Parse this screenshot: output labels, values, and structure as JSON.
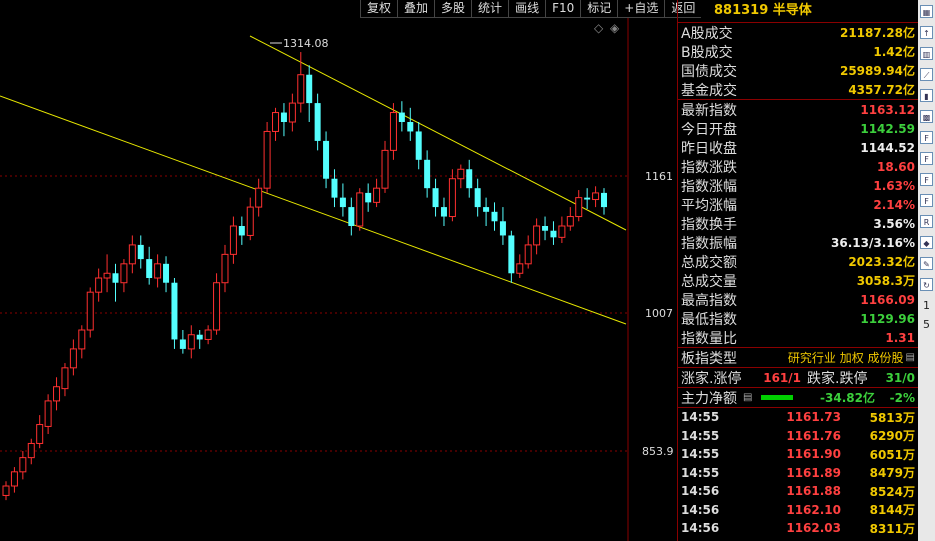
{
  "toolbar": {
    "items": [
      "复权",
      "叠加",
      "多股",
      "统计",
      "画线",
      "F10",
      "标记",
      "+自选",
      "返回"
    ]
  },
  "chart_labels": {
    "high_label": "1314.08",
    "price_1161": "1161",
    "price_1007": "1007",
    "price_853": "853.9"
  },
  "chart_data": {
    "type": "candlestick",
    "title": "",
    "ylim": [
      800,
      1350
    ],
    "gridlines": [
      1161,
      1007,
      853.9
    ],
    "candles": [
      [
        845,
        855,
        840,
        860
      ],
      [
        855,
        870,
        848,
        875
      ],
      [
        870,
        885,
        862,
        892
      ],
      [
        885,
        900,
        878,
        905
      ],
      [
        900,
        920,
        895,
        930
      ],
      [
        918,
        945,
        910,
        952
      ],
      [
        945,
        960,
        935,
        970
      ],
      [
        958,
        980,
        950,
        985
      ],
      [
        980,
        1000,
        972,
        1010
      ],
      [
        1000,
        1020,
        990,
        1025
      ],
      [
        1020,
        1060,
        1012,
        1065
      ],
      [
        1060,
        1075,
        1050,
        1085
      ],
      [
        1075,
        1080,
        1060,
        1100
      ],
      [
        1080,
        1070,
        1050,
        1090
      ],
      [
        1070,
        1090,
        1060,
        1095
      ],
      [
        1090,
        1110,
        1080,
        1120
      ],
      [
        1110,
        1095,
        1085,
        1120
      ],
      [
        1095,
        1075,
        1068,
        1108
      ],
      [
        1075,
        1090,
        1065,
        1100
      ],
      [
        1090,
        1070,
        1060,
        1098
      ],
      [
        1070,
        1010,
        1000,
        1075
      ],
      [
        1010,
        1000,
        995,
        1020
      ],
      [
        1000,
        1015,
        990,
        1025
      ],
      [
        1015,
        1010,
        1000,
        1020
      ],
      [
        1010,
        1020,
        1005,
        1025
      ],
      [
        1020,
        1070,
        1015,
        1080
      ],
      [
        1070,
        1100,
        1060,
        1110
      ],
      [
        1100,
        1130,
        1090,
        1140
      ],
      [
        1130,
        1120,
        1110,
        1140
      ],
      [
        1120,
        1150,
        1115,
        1160
      ],
      [
        1150,
        1170,
        1140,
        1180
      ],
      [
        1170,
        1230,
        1165,
        1240
      ],
      [
        1230,
        1250,
        1220,
        1255
      ],
      [
        1250,
        1240,
        1225,
        1260
      ],
      [
        1240,
        1260,
        1230,
        1270
      ],
      [
        1260,
        1290,
        1250,
        1314
      ],
      [
        1290,
        1260,
        1240,
        1300
      ],
      [
        1260,
        1220,
        1210,
        1270
      ],
      [
        1220,
        1180,
        1170,
        1230
      ],
      [
        1180,
        1160,
        1150,
        1190
      ],
      [
        1160,
        1150,
        1140,
        1175
      ],
      [
        1150,
        1130,
        1120,
        1160
      ],
      [
        1130,
        1165,
        1125,
        1170
      ],
      [
        1165,
        1155,
        1145,
        1175
      ],
      [
        1155,
        1170,
        1150,
        1180
      ],
      [
        1170,
        1210,
        1165,
        1220
      ],
      [
        1210,
        1250,
        1200,
        1260
      ],
      [
        1250,
        1240,
        1230,
        1262
      ],
      [
        1240,
        1230,
        1220,
        1255
      ],
      [
        1230,
        1200,
        1190,
        1240
      ],
      [
        1200,
        1170,
        1160,
        1210
      ],
      [
        1170,
        1150,
        1140,
        1180
      ],
      [
        1150,
        1140,
        1130,
        1160
      ],
      [
        1140,
        1180,
        1135,
        1190
      ],
      [
        1180,
        1190,
        1170,
        1195
      ],
      [
        1190,
        1170,
        1160,
        1200
      ],
      [
        1170,
        1150,
        1140,
        1180
      ],
      [
        1150,
        1145,
        1130,
        1160
      ],
      [
        1145,
        1135,
        1125,
        1155
      ],
      [
        1135,
        1120,
        1110,
        1150
      ],
      [
        1120,
        1080,
        1070,
        1125
      ],
      [
        1080,
        1090,
        1075,
        1100
      ],
      [
        1090,
        1110,
        1085,
        1120
      ],
      [
        1110,
        1130,
        1100,
        1138
      ],
      [
        1130,
        1125,
        1115,
        1140
      ],
      [
        1125,
        1118,
        1110,
        1135
      ],
      [
        1118,
        1130,
        1112,
        1140
      ],
      [
        1130,
        1140,
        1125,
        1150
      ],
      [
        1140,
        1160,
        1135,
        1168
      ],
      [
        1160,
        1158,
        1148,
        1170
      ],
      [
        1158,
        1165,
        1150,
        1172
      ],
      [
        1165,
        1150,
        1142,
        1170
      ]
    ]
  },
  "panel": {
    "title": "881319 半导体",
    "rows": [
      {
        "label": "A股成交",
        "value": "21187.28亿",
        "color": "yel"
      },
      {
        "label": "B股成交",
        "value": "1.42亿",
        "color": "yel"
      },
      {
        "label": "国债成交",
        "value": "25989.94亿",
        "color": "yel"
      },
      {
        "label": "基金成交",
        "value": "4357.72亿",
        "color": "yel"
      },
      {
        "label": "最新指数",
        "value": "1163.12",
        "color": "red"
      },
      {
        "label": "今日开盘",
        "value": "1142.59",
        "color": "grn"
      },
      {
        "label": "昨日收盘",
        "value": "1144.52",
        "color": "wht"
      },
      {
        "label": "指数涨跌",
        "value": "18.60",
        "color": "red"
      },
      {
        "label": "指数涨幅",
        "value": "1.63%",
        "color": "red"
      },
      {
        "label": "平均涨幅",
        "value": "2.14%",
        "color": "red"
      },
      {
        "label": "指数换手",
        "value": "3.56%",
        "color": "wht"
      },
      {
        "label": "指数振幅",
        "value": "36.13/3.16%",
        "color": "wht"
      },
      {
        "label": "总成交额",
        "value": "2023.32亿",
        "color": "yel"
      },
      {
        "label": "总成交量",
        "value": "3058.3万",
        "color": "yel"
      },
      {
        "label": "最高指数",
        "value": "1166.09",
        "color": "red"
      },
      {
        "label": "最低指数",
        "value": "1129.96",
        "color": "grn"
      },
      {
        "label": "指数量比",
        "value": "1.31",
        "color": "red"
      }
    ],
    "board_type_label": "板指类型",
    "board_type_value": "研究行业 加权 成份股",
    "up_label": "涨家.涨停",
    "up_value": "161/1",
    "down_label": "跌家.跌停",
    "down_value": "31/0",
    "net_label": "主力净额",
    "net_value": "-34.82亿",
    "net_pct": "-2%"
  },
  "ticks": [
    {
      "time": "14:55",
      "price": "1161.73",
      "vol": "5813万"
    },
    {
      "time": "14:55",
      "price": "1161.76",
      "vol": "6290万"
    },
    {
      "time": "14:55",
      "price": "1161.90",
      "vol": "6051万"
    },
    {
      "time": "14:55",
      "price": "1161.89",
      "vol": "8479万"
    },
    {
      "time": "14:56",
      "price": "1161.88",
      "vol": "8524万"
    },
    {
      "time": "14:56",
      "price": "1162.10",
      "vol": "8144万"
    },
    {
      "time": "14:56",
      "price": "1162.03",
      "vol": "8311万"
    }
  ],
  "sidebar_icons": [
    "cal-icon",
    "up-arrow-icon",
    "bar-chart-icon",
    "line-chart-icon",
    "candle-icon",
    "grid-icon",
    "f10-icon",
    "f11-icon",
    "f12-icon",
    "f13-icon",
    "rs-icon",
    "diamond-icon",
    "pencil-icon",
    "cycle-icon"
  ],
  "sidebar_bottom": [
    "1",
    "5"
  ]
}
